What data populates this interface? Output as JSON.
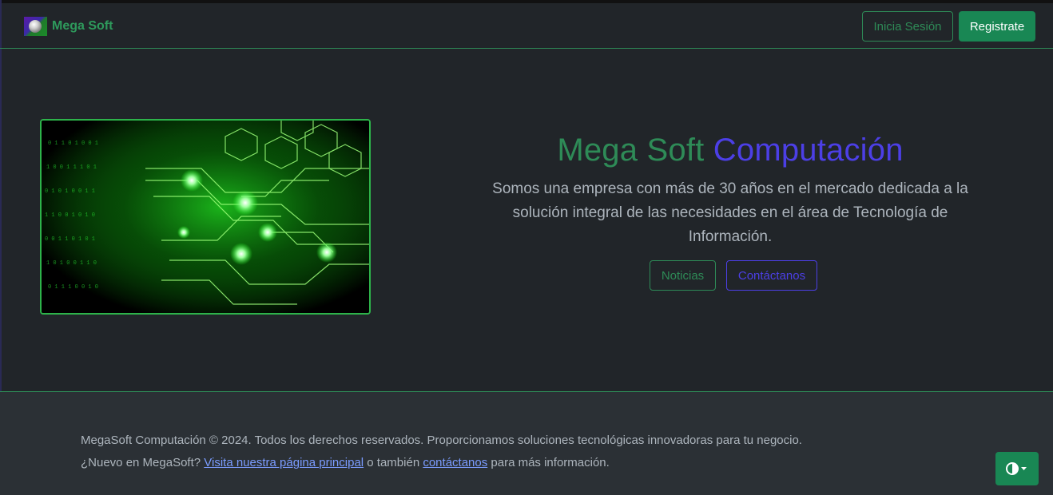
{
  "brand": {
    "name": "Mega Soft",
    "logo_icon": "megasoft-logo-icon"
  },
  "nav": {
    "login_label": "Inicia Sesión",
    "register_label": "Registrate"
  },
  "hero": {
    "title_part1": "Mega Soft",
    "title_part2": "Computación",
    "description": "Somos una empresa con más de 30 años en el mercado dedicada a la solución integral de las necesidades en el área de Tecnología de Información.",
    "news_label": "Noticias",
    "contact_label": "Contáctanos",
    "image_icon": "circuit-board-image"
  },
  "footer": {
    "line1": "MegaSoft Computación © 2024. Todos los derechos reservados. Proporcionamos soluciones tecnológicas innovadoras para tu negocio.",
    "line2_prefix": "¿Nuevo en MegaSoft? ",
    "main_link": "Visita nuestra página principal",
    "line2_middle": " o también ",
    "contact_link": "contáctanos",
    "line2_suffix": " para más información."
  },
  "theme_toggle": {
    "icon": "contrast-icon"
  },
  "colors": {
    "primary_green": "#2e8b57",
    "accent_blue": "#4c3fe6",
    "bg": "#212529",
    "button_green": "#198754"
  }
}
